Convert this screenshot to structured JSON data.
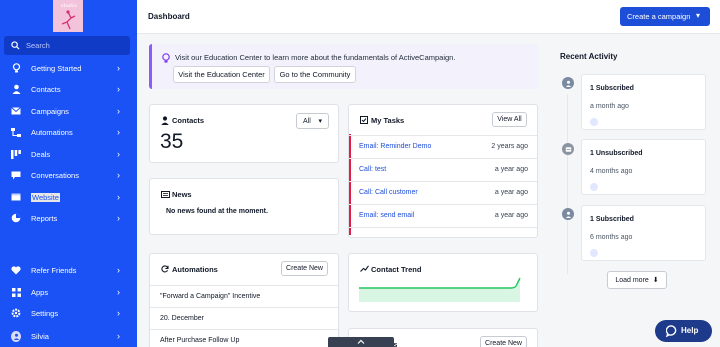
{
  "sidebar": {
    "logo_text": "studio",
    "search_label": "Search",
    "items": [
      {
        "label": "Getting Started",
        "icon": "lightbulb-icon"
      },
      {
        "label": "Contacts",
        "icon": "person-icon"
      },
      {
        "label": "Campaigns",
        "icon": "email-icon"
      },
      {
        "label": "Automations",
        "icon": "automation-icon"
      },
      {
        "label": "Deals",
        "icon": "deals-icon"
      },
      {
        "label": "Conversations",
        "icon": "chat-icon"
      },
      {
        "label": "Website",
        "icon": "website-icon"
      },
      {
        "label": "Reports",
        "icon": "pie-chart-icon"
      }
    ],
    "bottom_items": [
      {
        "label": "Refer Friends",
        "icon": "heart-icon"
      },
      {
        "label": "Apps",
        "icon": "apps-icon"
      },
      {
        "label": "Settings",
        "icon": "gear-icon"
      },
      {
        "label": "Silvia",
        "icon": "avatar-icon"
      }
    ],
    "chevron": "›"
  },
  "header": {
    "title": "Dashboard",
    "create_button": "Create a campaign"
  },
  "banner": {
    "text": "Visit our Education Center to learn more about the fundamentals of ActiveCampaign.",
    "button_education": "Visit the Education Center",
    "button_community": "Go to the Community"
  },
  "contacts": {
    "title": "Contacts",
    "filter": "All",
    "count": "35"
  },
  "news": {
    "title": "News",
    "empty": "No news found at the moment."
  },
  "tasks": {
    "title": "My Tasks",
    "view_all": "View All",
    "rows": [
      {
        "title": "Email: Reminder Demo",
        "when": "2 years ago"
      },
      {
        "title": "Call: test",
        "when": "a year ago"
      },
      {
        "title": "Call: Call customer",
        "when": "a year ago"
      },
      {
        "title": "Email: send email",
        "when": "a year ago"
      }
    ]
  },
  "automations": {
    "title": "Automations",
    "create": "Create New",
    "rows": [
      "\"Forward a Campaign\" Incentive",
      "20. December",
      "After Purchase Follow Up"
    ]
  },
  "contact_trend": {
    "title": "Contact Trend"
  },
  "lower_card": {
    "title_partial": "igns",
    "create": "Create New"
  },
  "activity": {
    "title": "Recent Activity",
    "items": [
      {
        "headline": "1 Subscribed",
        "time": "a month ago"
      },
      {
        "headline": "1 Unsubscribed",
        "time": "4 months ago"
      },
      {
        "headline": "1 Subscribed",
        "time": "6 months ago"
      }
    ],
    "load_more": "Load more"
  },
  "help": {
    "label": "Help"
  },
  "colors": {
    "sidebar": "#1b52f5",
    "primary_button": "#1d4ed8",
    "task_accent": "#e11d48",
    "trend_line": "#22c55e",
    "help_button": "#1e3a8a"
  }
}
